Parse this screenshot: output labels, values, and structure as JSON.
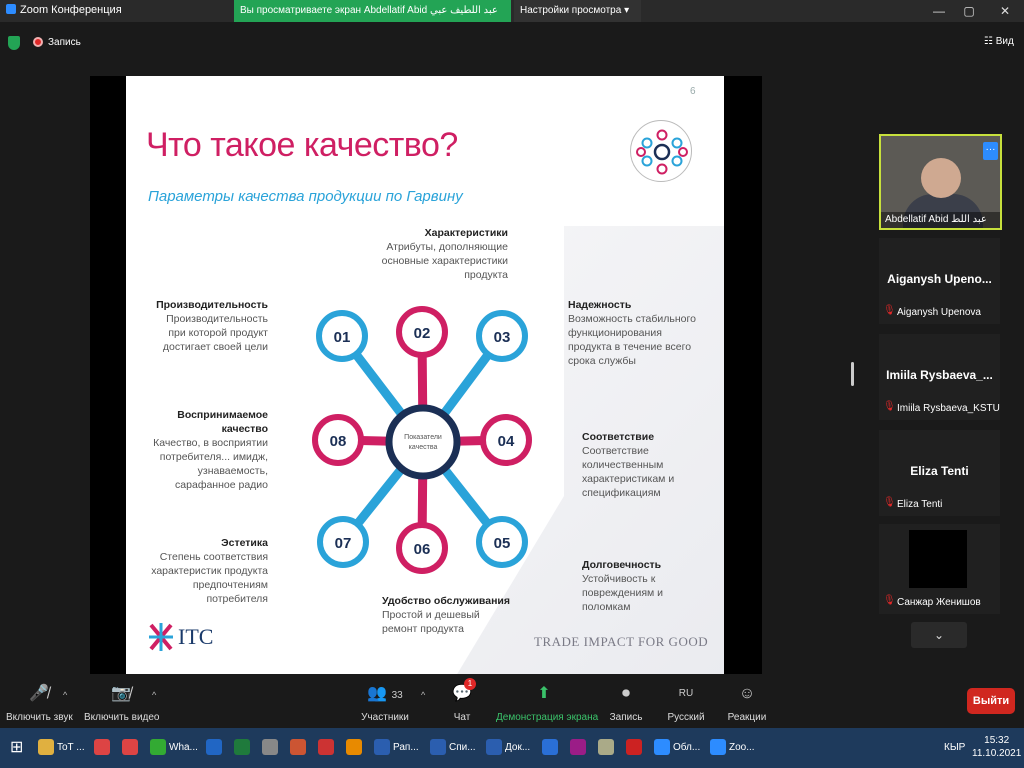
{
  "window": {
    "title": "Zoom Конференция",
    "share_banner": "Вы просматриваете экран Abdellatif Abid عبد اللطيف عبي",
    "view_settings": "Настройки просмотра",
    "minimize": "—",
    "maximize": "▢",
    "close": "✕"
  },
  "top": {
    "recording": "Запись",
    "view": "Вид"
  },
  "slide": {
    "number": "6",
    "title": "Что такое качество?",
    "subtitle": "Параметры качества продукции по Гарвину",
    "center_label": "Показатели качества",
    "nodes": [
      "01",
      "02",
      "03",
      "04",
      "05",
      "06",
      "07",
      "08"
    ],
    "items": {
      "performance": {
        "title": "Производительность",
        "text": "Производительность при которой продукт достигает своей цели"
      },
      "features": {
        "title": "Характеристики",
        "text": "Атрибуты, дополняющие основные характеристики продукта"
      },
      "reliability": {
        "title": "Надежность",
        "text": "Возможность стабильного функционирования продукта в течение всего срока службы"
      },
      "conformance": {
        "title": "Соответствие",
        "text": "Соответствие количественным характеристикам и спецификациям"
      },
      "durability": {
        "title": "Долговечность",
        "text": "Устойчивость к повреждениям и поломкам"
      },
      "serviceability": {
        "title": "Удобство обслуживания",
        "text": "Простой и дешевый ремонт продукта"
      },
      "aesthetics": {
        "title": "Эстетика",
        "text": "Степень соответствия характеристик продукта предпочтениям потребителя"
      },
      "perceived": {
        "title": "Воспринимаемое качество",
        "text": "Качество, в восприятии потребителя... имидж, узнаваемость, сарафанное радио"
      }
    },
    "logo": "ITC",
    "tagline": "TRADE IMPACT FOR GOOD",
    "colors": {
      "pink": "#cf1f63",
      "blue": "#2aa3d9",
      "navy": "#1b2f55"
    }
  },
  "participants": {
    "video": {
      "name": "Abdellatif Abid عبد اللط",
      "more": "···"
    },
    "tiles": [
      {
        "big": "Aiganysh Upeno...",
        "small": "Aiganysh Upenova"
      },
      {
        "big": "Imiila Rysbaeva_...",
        "small": "Imiila Rysbaeva_KSTU"
      },
      {
        "big": "Eliza Tenti",
        "small": "Eliza Tenti"
      },
      {
        "big": "",
        "small": "Санжар Женишов"
      }
    ]
  },
  "toolbar": {
    "mute": "Включить звук",
    "video": "Включить видео",
    "participants": "Участники",
    "participants_count": "33",
    "chat": "Чат",
    "chat_badge": "1",
    "share": "Демонстрация экрана",
    "record": "Запись",
    "language": "Русский",
    "language_code": "RU",
    "reactions": "Реакции",
    "exit": "Выйти"
  },
  "taskbar": {
    "items": [
      {
        "label": "ToT ...",
        "color": "#e0b040"
      },
      {
        "label": "",
        "color": "#d44"
      },
      {
        "label": "",
        "color": "#d44"
      },
      {
        "label": "Wha...",
        "color": "#3a3"
      },
      {
        "label": "",
        "color": "#2166c4"
      },
      {
        "label": "",
        "color": "#1f7a3c"
      },
      {
        "label": "",
        "color": "#888"
      },
      {
        "label": "",
        "color": "#c53"
      },
      {
        "label": "",
        "color": "#c33"
      },
      {
        "label": "",
        "color": "#e88a00"
      },
      {
        "label": "Рап...",
        "color": "#2b5eaf"
      },
      {
        "label": "Спи...",
        "color": "#2b5eaf"
      },
      {
        "label": "Док...",
        "color": "#2b5eaf"
      },
      {
        "label": "",
        "color": "#2a6fd6"
      },
      {
        "label": "",
        "color": "#9b1d87"
      },
      {
        "label": "",
        "color": "#aa8"
      },
      {
        "label": "",
        "color": "#c22"
      },
      {
        "label": "Обл...",
        "color": "#2d8cff"
      },
      {
        "label": "Zoo...",
        "color": "#2d8cff"
      }
    ],
    "lang": "КЫР",
    "time": "15:32",
    "date": "11.10.2021"
  }
}
